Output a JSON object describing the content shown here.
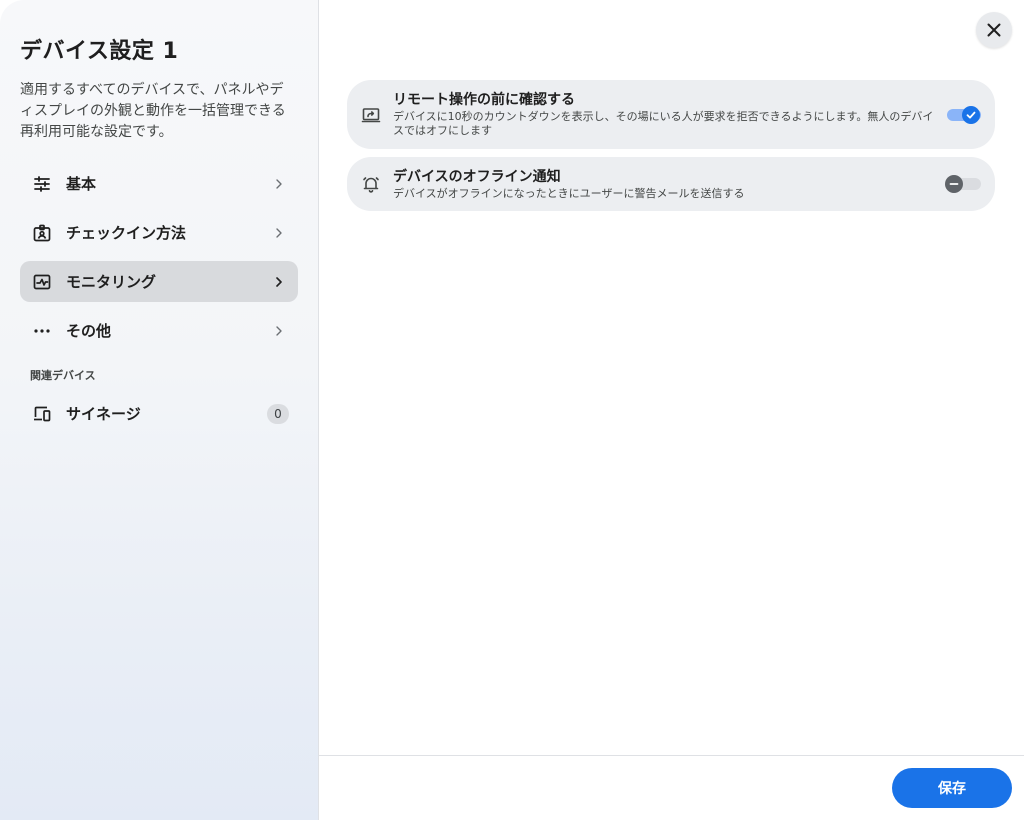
{
  "sidebar": {
    "title": "デバイス設定 1",
    "description": "適用するすべてのデバイスで、パネルやディスプレイの外観と動作を一括管理できる再利用可能な設定です。",
    "items": [
      {
        "label": "基本",
        "icon": "tune-icon"
      },
      {
        "label": "チェックイン方法",
        "icon": "badge-icon"
      },
      {
        "label": "モニタリング",
        "icon": "monitoring-icon",
        "active": true
      },
      {
        "label": "その他",
        "icon": "more-horiz-icon"
      }
    ],
    "section_label": "関連デバイス",
    "related": {
      "label": "サイネージ",
      "icon": "devices-icon",
      "count": "0"
    }
  },
  "settings": [
    {
      "title": "リモート操作の前に確認する",
      "description": "デバイスに10秒のカウントダウンを表示し、その場にいる人が要求を拒否できるようにします。無人のデバイスではオフにします",
      "icon": "screen-share-icon",
      "enabled": true
    },
    {
      "title": "デバイスのオフライン通知",
      "description": "デバイスがオフラインになったときにユーザーに警告メールを送信する",
      "icon": "bell-icon",
      "enabled": false
    }
  ],
  "footer": {
    "save_label": "保存"
  },
  "colors": {
    "accent": "#1a73e8",
    "active_nav": "#d8dadd",
    "card": "#eceef1"
  }
}
